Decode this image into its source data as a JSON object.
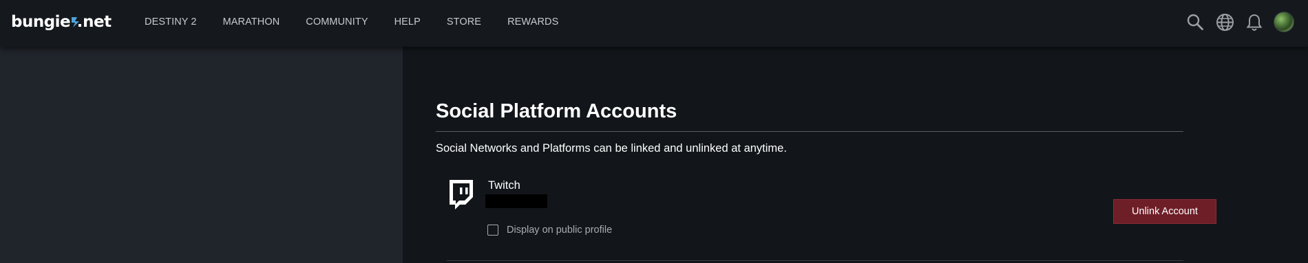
{
  "header": {
    "logo_left": "bungie",
    "logo_right": "net",
    "nav_items": [
      {
        "label": "DESTINY 2"
      },
      {
        "label": "MARATHON"
      },
      {
        "label": "COMMUNITY"
      },
      {
        "label": "HELP"
      },
      {
        "label": "STORE"
      },
      {
        "label": "REWARDS"
      }
    ],
    "icons": [
      "search-icon",
      "globe-icon",
      "bell-icon",
      "avatar"
    ]
  },
  "main": {
    "title": "Social Platform Accounts",
    "description": "Social Networks and Platforms can be linked and unlinked at anytime.",
    "platforms": [
      {
        "name": "Twitch",
        "icon": "twitch-icon",
        "public_label": "Display on public profile",
        "public_checked": false,
        "button_label": "Unlink Account"
      }
    ]
  },
  "colors": {
    "nav_bg": "#15191d",
    "left_panel_bg": "#20242b",
    "main_bg": "#12161a",
    "unlink_button": "#6e1e27"
  }
}
